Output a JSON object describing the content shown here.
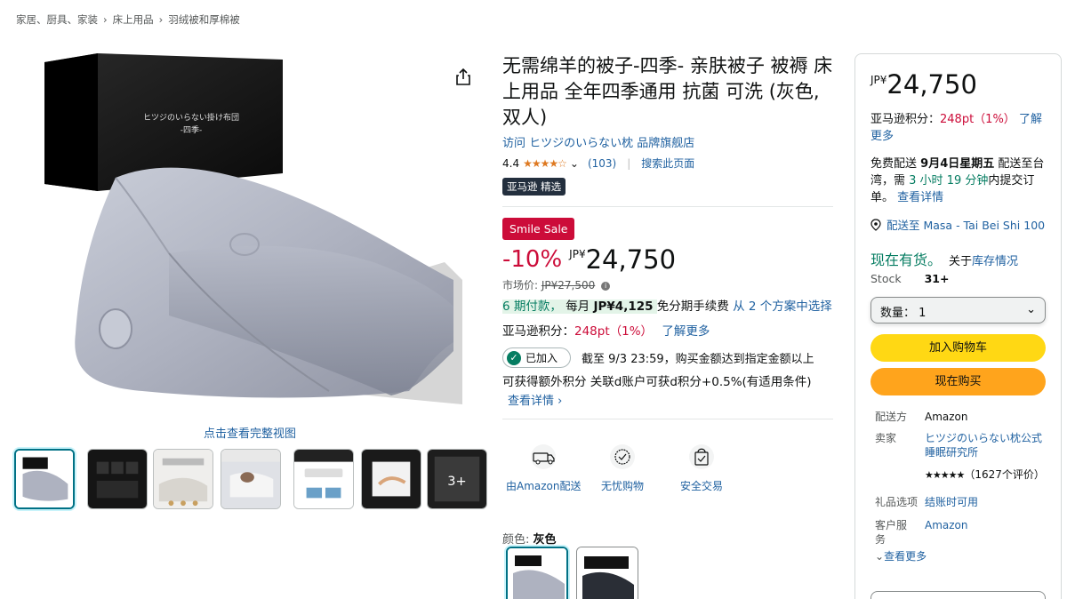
{
  "breadcrumb": [
    "家居、厨具、家装",
    "床上用品",
    "羽绒被和厚棉被"
  ],
  "gallery": {
    "view_full": "点击查看完整视图",
    "more_count": "3+",
    "box_text_line1": "ヒツジのいらない掛け布団",
    "box_text_line2": "-四季-"
  },
  "product": {
    "title": "无需绵羊的被子-四季- 亲肤被子 被褥 床上用品 全年四季通用 抗菌 可洗 (灰色, 双人)",
    "store_link": "访问 ヒツジのいらない枕 品牌旗舰店",
    "rating_value": "4.4",
    "stars": "★★★★☆",
    "rating_count": "(103)",
    "search_page": "搜索此页面",
    "choice_badge": "亚马逊 精选",
    "smile_badge": "Smile Sale",
    "discount": "-10%",
    "currency": "JP¥",
    "price": "24,750",
    "list_price_label": "市场价:",
    "list_price": "JP¥27,500",
    "installment_prefix": "6 期付款，",
    "installment_monthly": "每月",
    "installment_amount": "JP¥4,125",
    "installment_fee": "免分期手续费",
    "installment_plans": "从 2 个方案中选择",
    "points_label": "亚马逊积分：",
    "points_value": "248pt（1%）",
    "points_more": "了解更多",
    "joined_label": "已加入",
    "deadline_text": "截至 9/3 23:59，购买金额达到指定金额以上",
    "bonus_text": "可获得额外积分 关联d账户可获d积分+0.5%(有适用条件)",
    "more_details": "查看详情 ›",
    "features": [
      "由Amazon配送",
      "无忧购物",
      "安全交易"
    ],
    "color_label": "颜色:",
    "color_value": "灰色"
  },
  "buybox": {
    "currency": "JP¥",
    "price": "24,750",
    "points_label": "亚马逊积分：",
    "points_value": "248pt（1%）",
    "points_more": "了解更多",
    "delivery_prefix": "免费配送",
    "delivery_date": "9月4日星期五",
    "delivery_to": "配送至台湾，需",
    "delivery_time": "3 小时 19 分钟",
    "delivery_suffix": "内提交订单。",
    "delivery_details": "查看详情",
    "location": "配送至 Masa - Tai Bei Shi 100",
    "stock_status": "现在有货。",
    "stock_about": "关于",
    "stock_link": "库存情况",
    "stock_label": "Stock",
    "stock_count": "31+",
    "qty_label": "数量：",
    "qty_value": "1",
    "add_to_cart": "加入购物车",
    "buy_now": "现在购买",
    "ships_from_label": "配送方",
    "ships_from": "Amazon",
    "seller_label": "卖家",
    "seller": "ヒツジのいらない枕公式睡眠研究所",
    "seller_stars": "★★★★★",
    "seller_reviews": "（1627个评价）",
    "gift_label": "礼品选项",
    "gift_value": "结账时可用",
    "service_label": "客户服务",
    "service_value": "Amazon",
    "see_more": "查看更多"
  },
  "colors": {
    "link": "#2162a1",
    "price_red": "#cc0c39",
    "stock_green": "#067d62",
    "cart_yellow": "#ffd814",
    "buy_orange": "#ffa41c"
  }
}
